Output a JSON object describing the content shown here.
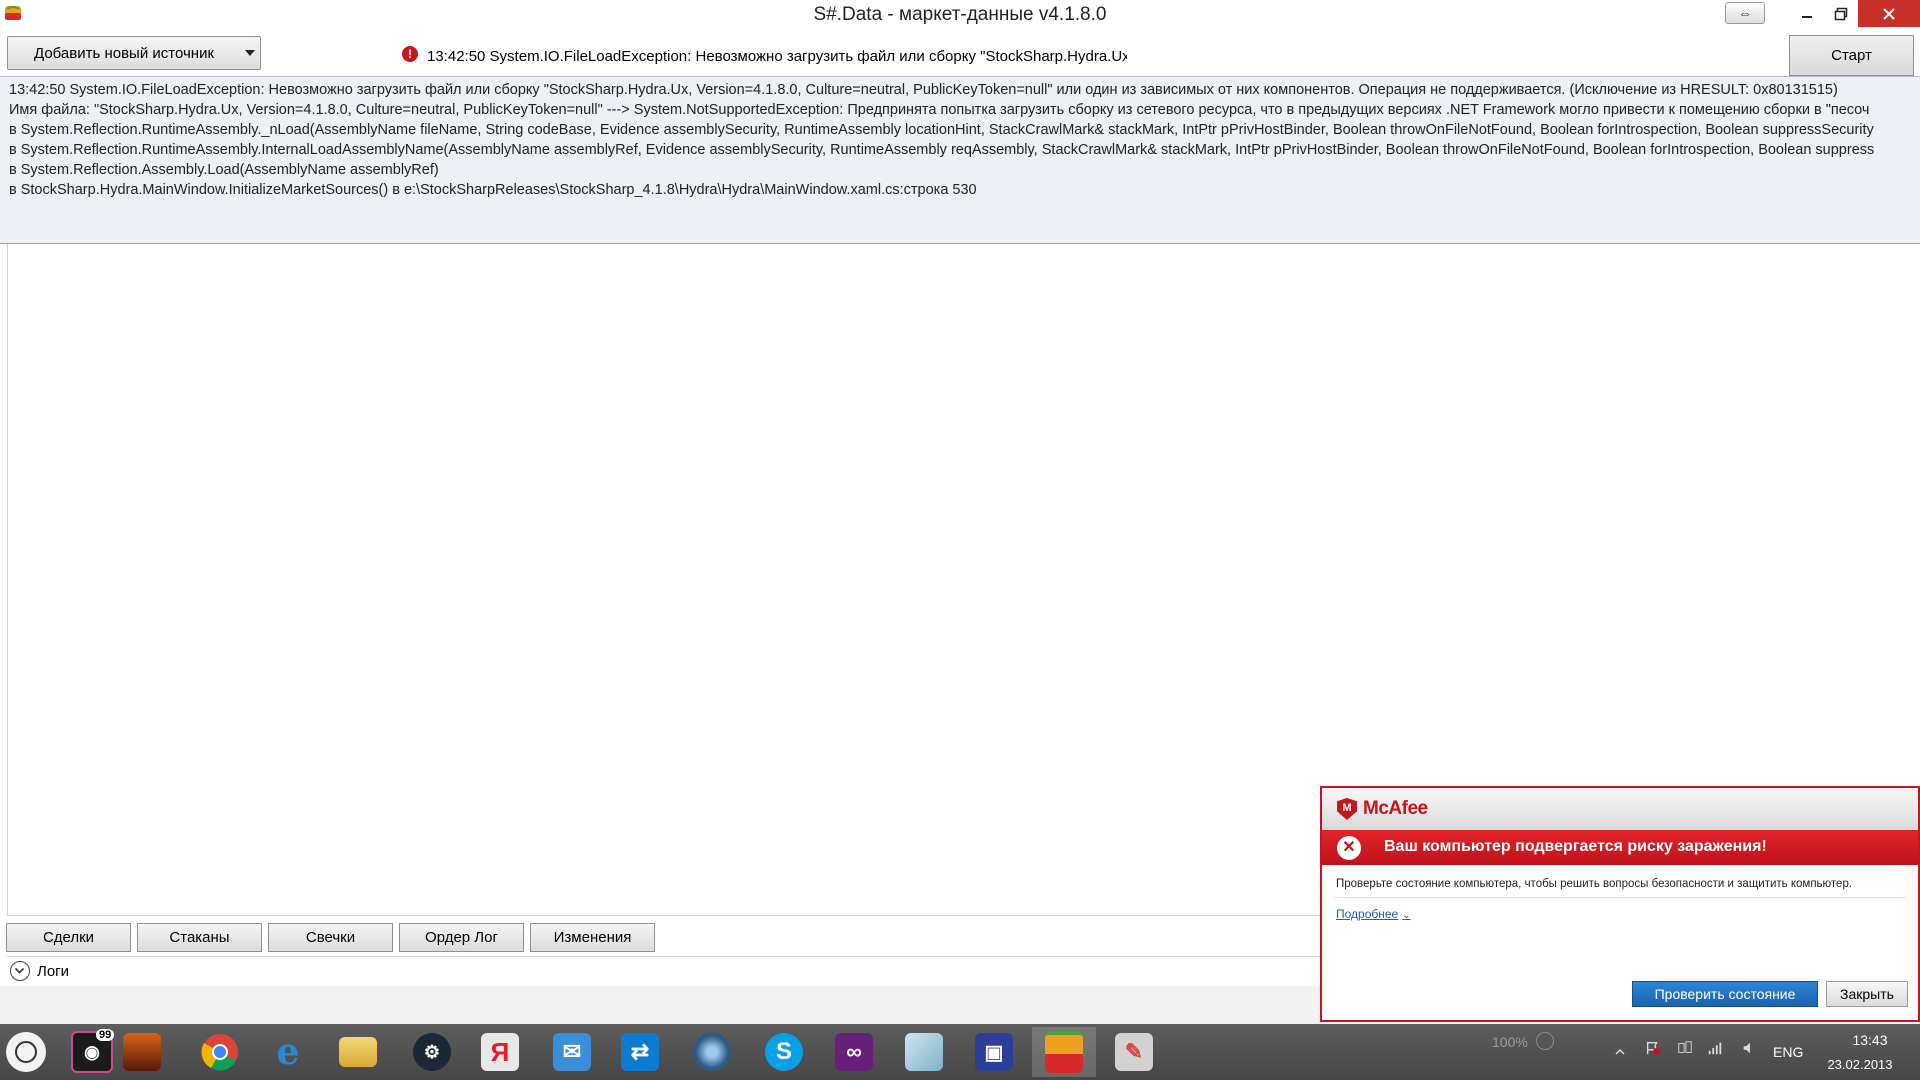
{
  "window": {
    "title": "S#.Data - маркет-данные v4.1.8.0"
  },
  "toolbar": {
    "add_source_label": "Добавить новый источник",
    "error_summary": "13:42:50  System.IO.FileLoadException: Невозможно загрузить файл или сборку \"StockSharp.Hydra.Ux.",
    "start_label": "Старт"
  },
  "log": {
    "lines": [
      "13:42:50  System.IO.FileLoadException: Невозможно загрузить файл или сборку \"StockSharp.Hydra.Ux, Version=4.1.8.0, Culture=neutral, PublicKeyToken=null\" или один из зависимых от них компонентов. Операция не поддерживается. (Исключение из HRESULT: 0x80131515)",
      "Имя файла: \"StockSharp.Hydra.Ux, Version=4.1.8.0, Culture=neutral, PublicKeyToken=null\" ---> System.NotSupportedException: Предпринята попытка загрузить сборку из сетевого ресурса, что в предыдущих версиях .NET Framework могло привести к помещению сборки в \"песоч",
      "   в System.Reflection.RuntimeAssembly._nLoad(AssemblyName fileName, String codeBase, Evidence assemblySecurity, RuntimeAssembly locationHint, StackCrawlMark& stackMark, IntPtr pPrivHostBinder, Boolean throwOnFileNotFound, Boolean forIntrospection, Boolean suppressSecurity",
      "   в System.Reflection.RuntimeAssembly.InternalLoadAssemblyName(AssemblyName assemblyRef, Evidence assemblySecurity, RuntimeAssembly reqAssembly, StackCrawlMark& stackMark, IntPtr pPrivHostBinder, Boolean throwOnFileNotFound, Boolean forIntrospection, Boolean suppress",
      "   в System.Reflection.Assembly.Load(AssemblyName assemblyRef)",
      "   в StockSharp.Hydra.MainWindow.InitializeMarketSources() в e:\\StockSharpReleases\\StockSharp_4.1.8\\Hydra\\Hydra\\MainWindow.xaml.cs:строка 530"
    ]
  },
  "tabs": [
    "Сделки",
    "Стаканы",
    "Свечки",
    "Ордер Лог",
    "Изменения"
  ],
  "logs_section": {
    "label": "Логи"
  },
  "mcafee": {
    "brand": "McAfee",
    "alert": "Ваш компьютер подвергается риску заражения!",
    "body": "Проверьте состояние компьютера, чтобы решить вопросы безопасности и защитить компьютер.",
    "more_link": "Подробнее",
    "check_button": "Проверить состояние",
    "close_button": "Закрыть",
    "brand_color": "#c5161d"
  },
  "taskbar": {
    "badge_count": "99",
    "zoom": "100%",
    "language": "ENG",
    "time": "13:43",
    "date": "23.02.2013",
    "apps": [
      {
        "name": "camera-app-icon",
        "color": "#1b1b1b"
      },
      {
        "name": "game-dragon-icon",
        "color": "#8a2a0c"
      },
      {
        "name": "chrome-icon",
        "color": "#e5b521"
      },
      {
        "name": "internet-explorer-icon",
        "color": "#2a8ad6"
      },
      {
        "name": "file-explorer-icon",
        "color": "#e7c45a"
      },
      {
        "name": "steam-icon",
        "color": "#1b2838"
      },
      {
        "name": "yandex-icon",
        "color": "#e0e0e0"
      },
      {
        "name": "mail-icon",
        "color": "#3a8fd8"
      },
      {
        "name": "teamviewer-icon",
        "color": "#0e7bd2"
      },
      {
        "name": "disc-app-icon",
        "color": "#2b5a86"
      },
      {
        "name": "skype-icon",
        "color": "#0aa0e6"
      },
      {
        "name": "visual-studio-icon",
        "color": "#68217a"
      },
      {
        "name": "notepad-icon",
        "color": "#9ec6d8"
      },
      {
        "name": "floppy-save-icon",
        "color": "#2b3e9a"
      },
      {
        "name": "hydra-app-icon",
        "color": "#4aa43a"
      },
      {
        "name": "paint-icon",
        "color": "#c9c9c9"
      }
    ]
  }
}
